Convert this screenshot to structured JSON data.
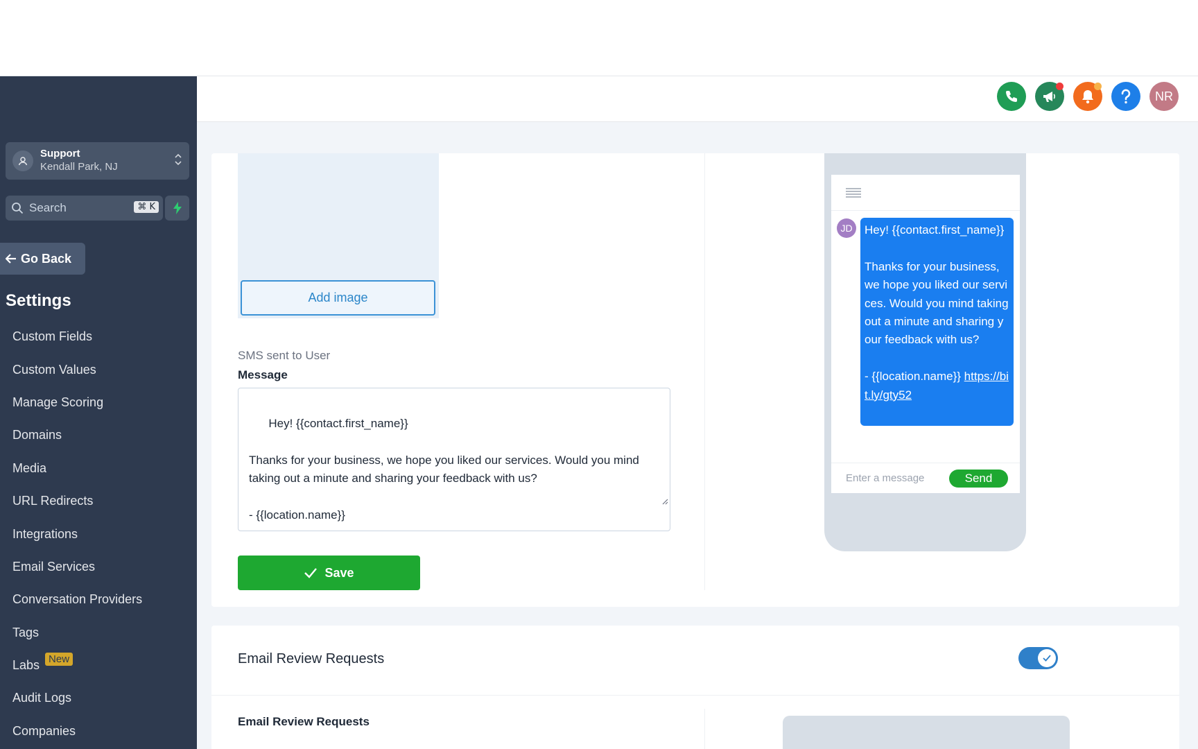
{
  "location": {
    "name": "Support",
    "address": "Kendall Park, NJ"
  },
  "search": {
    "placeholder": "Search",
    "shortcut": "⌘ K"
  },
  "nav": {
    "go_back": "Go Back",
    "title": "Settings",
    "items": [
      {
        "label": "Custom Fields"
      },
      {
        "label": "Custom Values"
      },
      {
        "label": "Manage Scoring"
      },
      {
        "label": "Domains"
      },
      {
        "label": "Media"
      },
      {
        "label": "URL Redirects"
      },
      {
        "label": "Integrations"
      },
      {
        "label": "Email Services"
      },
      {
        "label": "Conversation Providers"
      },
      {
        "label": "Tags"
      },
      {
        "label": "Labs",
        "badge": "New"
      },
      {
        "label": "Audit Logs"
      },
      {
        "label": "Companies"
      }
    ]
  },
  "header": {
    "user_initials": "NR",
    "icons": [
      "phone-icon",
      "megaphone-icon",
      "bell-icon",
      "help-icon"
    ]
  },
  "sms_card": {
    "add_image": "Add image",
    "subtitle": "SMS sent to User",
    "message_label": "Message",
    "message": "Hey! {{contact.first_name}}\n\nThanks for your business, we hope you liked our services. Would you mind taking out a minute and sharing your feedback with us?\n\n- {{location.name}}",
    "save": "Save"
  },
  "preview": {
    "avatar": "JD",
    "bubble_text": "Hey! {{contact.first_name}}\n\nThanks for your business, we hope you liked our services. Would you mind taking out a minute and sharing your feedback with us?\n\n- {{location.name}} ",
    "link": "https://bit.ly/gty52",
    "input_placeholder": "Enter a message",
    "send": "Send"
  },
  "email_card": {
    "title": "Email Review Requests",
    "enabled": true,
    "subtitle": "Email Review Requests"
  },
  "colors": {
    "sidebar": "#2e3a4f",
    "accent_green": "#1ea831",
    "bubble_blue": "#1a7ef0",
    "toggle_blue": "#2f80c9"
  }
}
